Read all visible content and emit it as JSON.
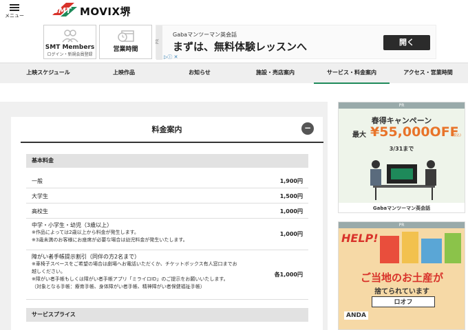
{
  "header": {
    "menu_label": "メニュー",
    "logo_text": "SMT",
    "site_title": "MOVIX堺"
  },
  "quicklinks": [
    {
      "title": "SMT Members",
      "sub": "ログイン・新規会員登録",
      "icon": "user-group-icon"
    },
    {
      "title": "営業時間",
      "sub": "",
      "icon": "clock-calendar-icon"
    }
  ],
  "top_ad": {
    "pr": "PR",
    "source": "Gabaマンツーマン英会話",
    "copy": "まずは、無料体験レッスンへ",
    "button": "開く"
  },
  "nav": {
    "items": [
      "上映スケジュール",
      "上映作品",
      "お知らせ",
      "施設・売店案内",
      "サービス・料金案内",
      "アクセス・営業時間"
    ],
    "active_index": 4
  },
  "pricing": {
    "title": "料金案内",
    "collapse_symbol": "−",
    "basic_header": "基本料金",
    "rows": [
      {
        "label": "一般",
        "price": "1,900円"
      },
      {
        "label": "大学生",
        "price": "1,500円"
      },
      {
        "label": "高校生",
        "price": "1,000円"
      },
      {
        "label": "中学・小学生・幼児（3歳以上）",
        "note1": "※作品によっては2歳以上から料金が発生します。",
        "note2": "※3歳未満のお客様にお座席が必要な場合は幼児料金が発生いたします。",
        "price": "1,000円"
      },
      {
        "label": "障がい者手帳提示割引（同伴の方2名まで）",
        "note1": "※車椅子スペースをご希望の場合は劇場へお電話いただくか、チケットボックス有人窓口までお",
        "note2": "越しください。",
        "note3": "※障がい者手帳もしくは障がい者手帳アプリ「ミライロID」のご提示をお願いいたします。",
        "note4": "（対象となる手帳：療育手帳、身体障がい者手帳、精神障がい者保健福祉手帳）",
        "price": "各1,000円"
      }
    ],
    "service_header": "サービスプライス"
  },
  "side_ad1": {
    "pr": "PR",
    "title": "春得キャンペーン",
    "max": "最大",
    "amount": "¥55,000OFF",
    "tax": "(税込)",
    "until": "3/31まで",
    "footer": "Gabaマンツーマン英会話"
  },
  "side_ad2": {
    "pr": "PR",
    "help": "HELP!",
    "line1": "ご当地のお土産が",
    "line2": "捨てられています",
    "brand": "ロオフ",
    "anda": "ANDA"
  },
  "colors": {
    "accent_green": "#1e8a5a",
    "ad_orange": "#e8742a",
    "ad_red": "#d8322a"
  }
}
